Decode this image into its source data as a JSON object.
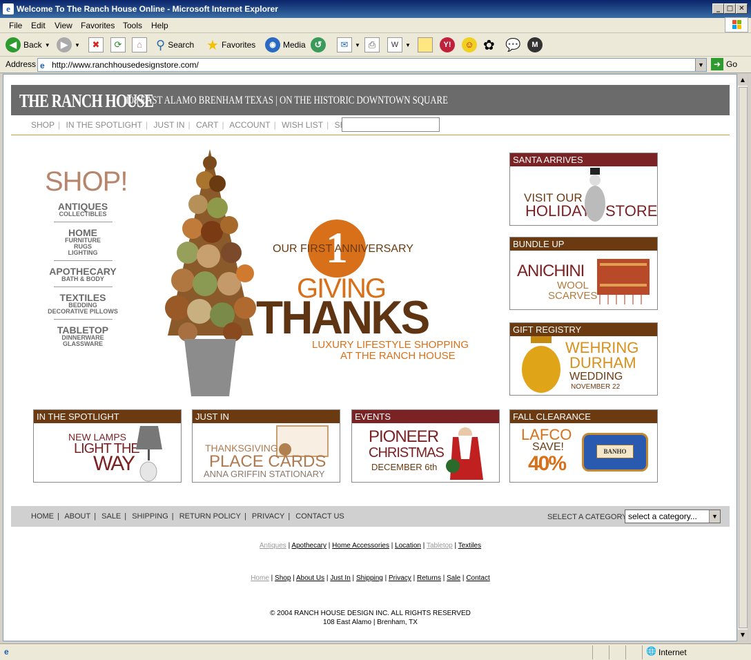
{
  "window": {
    "title": "Welcome To The Ranch House Online - Microsoft Internet Explorer"
  },
  "menu": [
    "File",
    "Edit",
    "View",
    "Favorites",
    "Tools",
    "Help"
  ],
  "toolbar": {
    "back": "Back",
    "search": "Search",
    "favorites": "Favorites",
    "media": "Media"
  },
  "address": {
    "label": "Address",
    "url": "http://www.ranchhousedesignstore.com/",
    "go": "Go"
  },
  "status": {
    "zone": "Internet"
  },
  "page": {
    "brand": "THE RANCH HOUSE",
    "tagline": "108 EAST ALAMO BRENHAM TEXAS | ON THE HISTORIC DOWNTOWN SQUARE",
    "nav": [
      "SHOP",
      "IN THE SPOTLIGHT",
      "JUST IN",
      "CART",
      "ACCOUNT",
      "WISH LIST",
      "SEARCH"
    ],
    "shop": {
      "title": "SHOP!",
      "categories": [
        {
          "name": "ANTIQUES",
          "subs": [
            "COLLECTIBLES"
          ]
        },
        {
          "name": "HOME",
          "subs": [
            "FURNITURE",
            "RUGS",
            "LIGHTING"
          ]
        },
        {
          "name": "APOTHECARY",
          "subs": [
            "BATH & BODY"
          ]
        },
        {
          "name": "TEXTILES",
          "subs": [
            "BEDDING",
            "DECORATIVE PILLOWS"
          ]
        },
        {
          "name": "TABLETOP",
          "subs": [
            "DINNERWARE",
            "GLASSWARE"
          ]
        }
      ]
    },
    "hero": {
      "anniv": "OUR FIRST ANNIVERSARY",
      "num": "1",
      "giving": "GIVING",
      "thanks": "THANKS",
      "line1": "LUXURY LIFESTYLE SHOPPING",
      "line2": "AT THE RANCH HOUSE"
    },
    "side": [
      {
        "header": "SANTA ARRIVES",
        "l1": "VISIT OUR",
        "l2": "HOLIDAY",
        "l3": "STORE"
      },
      {
        "header": "BUNDLE UP",
        "l1": "ANICHINI",
        "l2": "WOOL",
        "l3": "SCARVES"
      },
      {
        "header": "GIFT REGISTRY",
        "l1": "WEHRING",
        "l2": "DURHAM",
        "l3": "WEDDING",
        "l4": "NOVEMBER 22"
      }
    ],
    "bottom": [
      {
        "header": "IN THE SPOTLIGHT",
        "l1": "NEW LAMPS",
        "l2": "LIGHT THE",
        "l3": "WAY"
      },
      {
        "header": "JUST IN",
        "l1": "THANKSGIVING",
        "l2": "PLACE CARDS",
        "l3": "ANNA GRIFFIN STATIONARY"
      },
      {
        "header": "EVENTS",
        "l1": "PIONEER",
        "l2": "CHRISTMAS",
        "l3": "DECEMBER 6th"
      },
      {
        "header": "FALL CLEARANCE",
        "l1": "LAFCO",
        "l2": "SAVE!",
        "l3": "40%",
        "soap": "BANHO"
      }
    ],
    "footer_links": [
      "HOME",
      "ABOUT",
      "SALE",
      "SHIPPING",
      "RETURN POLICY",
      "PRIVACY",
      "CONTACT US"
    ],
    "select_label": "SELECT A CATEGORY",
    "select_value": "select a category...",
    "row1": [
      "Antiques",
      "Apothecary",
      "Home Accessories",
      "Location",
      "Tabletop",
      "Textiles"
    ],
    "row2": [
      "Home",
      "Shop",
      "About Us",
      "Just In",
      "Shipping",
      "Privacy",
      "Returns",
      "Sale",
      "Contact"
    ],
    "copyright": "© 2004 RANCH HOUSE DESIGN INC. ALL RIGHTS RESERVED",
    "address_line": "108 East Alamo | Brenham, TX"
  }
}
